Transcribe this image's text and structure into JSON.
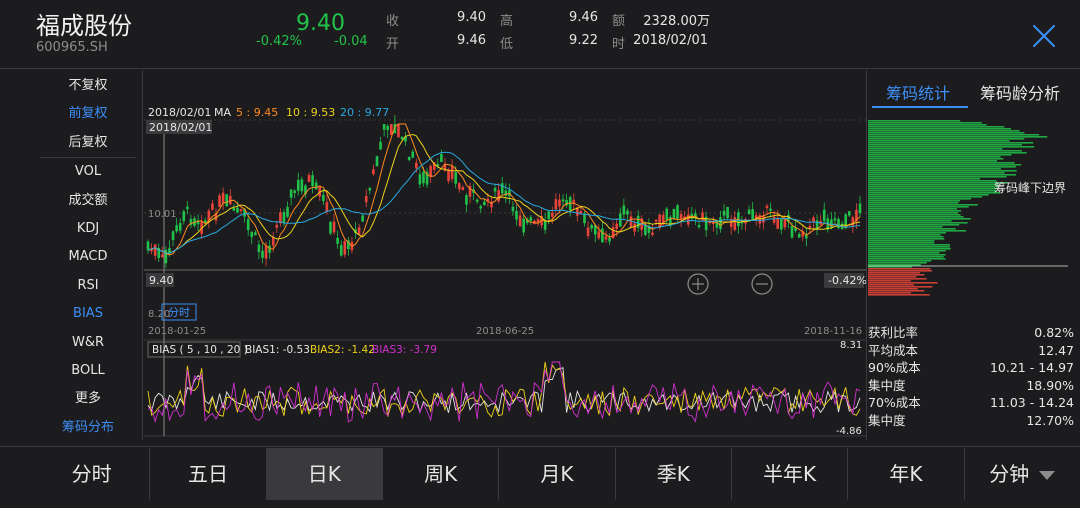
{
  "header": {
    "stock_name": "福成股份",
    "stock_code": "600965.SH",
    "price": "9.40",
    "change_pct": "-0.42%",
    "change": "-0.04",
    "fields": [
      {
        "label": "收",
        "value": "9.40"
      },
      {
        "label": "开",
        "value": "9.46"
      },
      {
        "label": "高",
        "value": "9.46"
      },
      {
        "label": "低",
        "value": "9.22"
      },
      {
        "label": "额",
        "value": "2328.00万"
      },
      {
        "label": "时",
        "value": "2018/02/01"
      }
    ]
  },
  "colors": {
    "up": "#e8443a",
    "down": "#21c24a",
    "accent": "#3d8ef7",
    "ma5": "#ff8a1f",
    "ma10": "#f0d21a",
    "ma20": "#29a9e0",
    "bias3": "#d030d0"
  },
  "side_menu": {
    "items": [
      "不复权",
      "前复权",
      "后复权",
      "VOL",
      "成交额",
      "KDJ",
      "MACD",
      "RSI",
      "BIAS",
      "W&R",
      "BOLL",
      "更多",
      "筹码分布"
    ],
    "active": [
      "前复权",
      "BIAS",
      "筹码分布"
    ]
  },
  "chart": {
    "ma_date": "2018/02/01",
    "ma_label": "MA",
    "ma5_label": "5 : 9.45",
    "ma10_label": "10 : 9.53",
    "ma20_label": "20 : 9.77",
    "cursor_date": "2018/02/01",
    "price_label": "9.40",
    "level_label": "10.01",
    "low_label": "8.20",
    "fenshi_tag": "分时",
    "change_tag": "-0.42%",
    "x_ticks": [
      "2018-01-25",
      "2018-06-25",
      "2018-11-16"
    ],
    "right_value": "8.31",
    "bias_header": "BIAS ( 5 , 10 , 20 )",
    "bias1": "BIAS1: -0.53",
    "bias2": "BIAS2: -1.42",
    "bias3": "BIAS3: -3.79",
    "bias_min": "-4.86"
  },
  "chip_panel": {
    "tabs": [
      "筹码统计",
      "筹码龄分析"
    ],
    "active_tab": "筹码统计",
    "annotation": "筹码峰下边界",
    "stats": [
      {
        "label": "获利比率",
        "value": "0.82%"
      },
      {
        "label": "平均成本",
        "value": "12.47"
      },
      {
        "label": "90%成本",
        "value": "10.21 - 14.97"
      },
      {
        "label": "集中度",
        "value": "18.90%"
      },
      {
        "label": "70%成本",
        "value": "11.03 - 14.24"
      },
      {
        "label": "集中度",
        "value": "12.70%"
      }
    ]
  },
  "bottom_tabs": {
    "items": [
      "分时",
      "五日",
      "日K",
      "周K",
      "月K",
      "季K",
      "半年K",
      "年K",
      "分钟"
    ],
    "active": "日K"
  }
}
